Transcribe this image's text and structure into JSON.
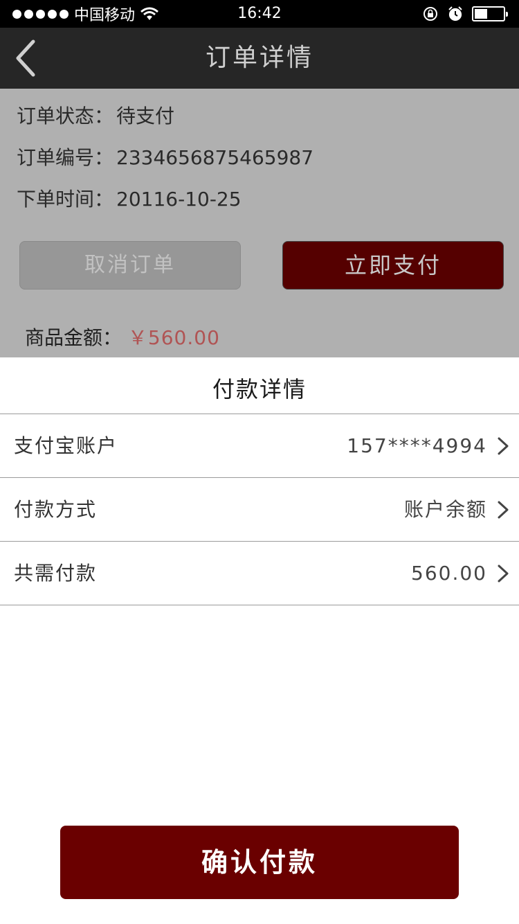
{
  "status_bar": {
    "carrier": "中国移动",
    "time": "16:42",
    "battery_level": 0.45,
    "icons": [
      "signal-dots-icon",
      "wifi-icon",
      "rotation-lock-icon",
      "alarm-icon",
      "battery-icon"
    ]
  },
  "nav": {
    "title": "订单详情",
    "back_icon": "chevron-left-icon"
  },
  "order": {
    "status_label": "订单状态：",
    "status_value": "待支付",
    "number_label": "订单编号：",
    "number_value": "2334656875465987",
    "time_label": "下单时间：",
    "time_value": "20116-10-25",
    "cancel_label": "取消订单",
    "pay_now_label": "立即支付",
    "amount_label": "商品金额：",
    "amount_value": "￥560.00"
  },
  "payment_sheet": {
    "title": "付款详情",
    "rows": [
      {
        "label": "支付宝账户",
        "value": "157****4994"
      },
      {
        "label": "付款方式",
        "value": "账户余额"
      },
      {
        "label": "共需付款",
        "value": "560.00"
      }
    ],
    "confirm_label": "确认付款"
  },
  "colors": {
    "nav_bg": "#262626",
    "overlay_bg": "#b0b0b0",
    "primary_dark_red": "#6a0000",
    "price_red": "#b05454"
  }
}
